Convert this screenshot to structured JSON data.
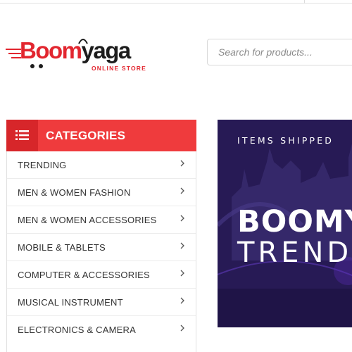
{
  "logo": {
    "word_part1": "Boom",
    "word_part2": "yaga",
    "tagline": "ONLINE STORE",
    "brand_red": "#e2262f",
    "brand_dark": "#1d1d1d"
  },
  "search": {
    "placeholder": "Search for products..."
  },
  "categories": {
    "title": "CATEGORIES",
    "header_color": "#ef3b3d",
    "icon": "list-icon",
    "items": [
      {
        "label": "TRENDING"
      },
      {
        "label": "MEN & WOMEN FASHION"
      },
      {
        "label": "MEN & WOMEN ACCESSORIES"
      },
      {
        "label": "MOBILE & TABLETS"
      },
      {
        "label": "COMPUTER & ACCESSORIES"
      },
      {
        "label": "MUSICAL INSTRUMENT"
      },
      {
        "label": "ELECTRONICS & CAMERA"
      }
    ]
  },
  "banner": {
    "top_text": "ITEMS SHIPPED",
    "headline": "BOOMY",
    "subline": "TREND",
    "background": "#271a55"
  }
}
